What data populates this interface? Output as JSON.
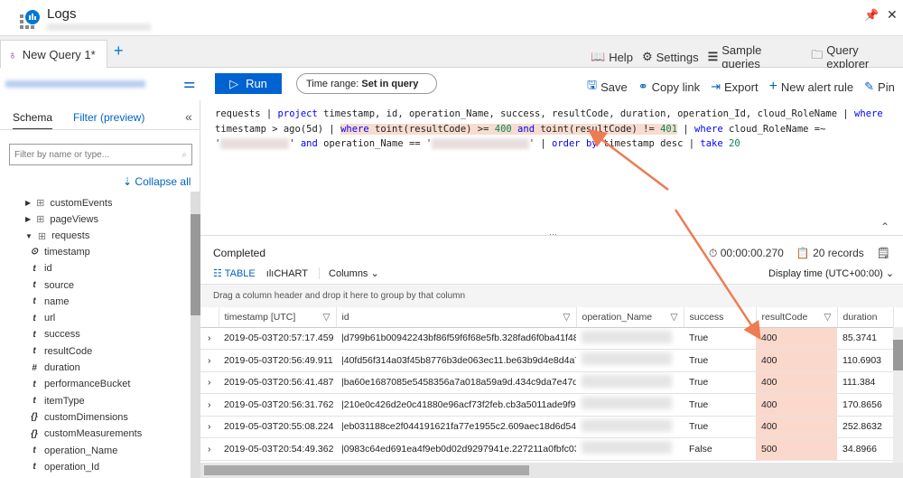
{
  "app": {
    "title": "Logs"
  },
  "tabs": [
    {
      "label": "New Query 1*"
    }
  ],
  "tabbar_actions": [
    {
      "label": "Help",
      "icon": "book-icon"
    },
    {
      "label": "Settings",
      "icon": "gear-icon"
    },
    {
      "label": "Sample queries",
      "icon": "list-icon"
    },
    {
      "label": "Query explorer",
      "icon": "folder-search-icon"
    }
  ],
  "toolbar": {
    "run": "Run",
    "time_range_label": "Time range:",
    "time_range_value": "Set in query",
    "actions": [
      {
        "label": "Save"
      },
      {
        "label": "Copy link"
      },
      {
        "label": "Export"
      },
      {
        "label": "New alert rule"
      },
      {
        "label": "Pin"
      }
    ]
  },
  "left": {
    "tab_schema": "Schema",
    "tab_filter": "Filter (preview)",
    "filter_placeholder": "Filter by name or type...",
    "collapse_all": "Collapse all",
    "tables": [
      {
        "label": "customEvents",
        "expanded": false
      },
      {
        "label": "pageViews",
        "expanded": false
      },
      {
        "label": "requests",
        "expanded": true
      }
    ],
    "fields": [
      {
        "type": "clock",
        "label": "timestamp"
      },
      {
        "type": "t",
        "label": "id"
      },
      {
        "type": "t",
        "label": "source"
      },
      {
        "type": "t",
        "label": "name"
      },
      {
        "type": "t",
        "label": "url"
      },
      {
        "type": "t",
        "label": "success"
      },
      {
        "type": "t",
        "label": "resultCode"
      },
      {
        "type": "#",
        "label": "duration"
      },
      {
        "type": "t",
        "label": "performanceBucket"
      },
      {
        "type": "t",
        "label": "itemType"
      },
      {
        "type": "{}",
        "label": "customDimensions"
      },
      {
        "type": "{}",
        "label": "customMeasurements"
      },
      {
        "type": "t",
        "label": "operation_Name"
      },
      {
        "type": "t",
        "label": "operation_Id"
      }
    ]
  },
  "query": [
    [
      [
        "requests | ",
        ""
      ],
      [
        "project",
        "kw"
      ],
      [
        " timestamp, id, operation_Name, success, resultCode, duration, operation_Id, cloud_RoleName | ",
        ""
      ],
      [
        "where",
        "kw"
      ]
    ],
    [
      [
        "timestamp > ago(5d) | ",
        ""
      ],
      [
        "where",
        "kw hl"
      ],
      [
        " toint(resultCode) >= ",
        "hl"
      ],
      [
        "400",
        "num hl"
      ],
      [
        " and",
        "kw hl"
      ],
      [
        " toint(resultCode) != ",
        "hl"
      ],
      [
        "401",
        "num hl"
      ],
      [
        " | ",
        ""
      ],
      [
        "where",
        "kw"
      ],
      [
        " cloud_RoleName =~",
        ""
      ]
    ],
    [
      [
        "'",
        ""
      ],
      [
        "xxxxxxxxxxxx",
        "blur"
      ],
      [
        "' ",
        ""
      ],
      [
        "and",
        "kw"
      ],
      [
        " operation_Name == '",
        ""
      ],
      [
        "xxxxxxxxxxxxxxxxx",
        "blur"
      ],
      [
        "' | ",
        ""
      ],
      [
        "order by",
        "kw"
      ],
      [
        " timestamp desc | ",
        ""
      ],
      [
        "take",
        "kw"
      ],
      [
        " ",
        ""
      ],
      [
        "20",
        "num"
      ]
    ]
  ],
  "results": {
    "status": "Completed",
    "duration": "00:00:00.270",
    "records": "20 records",
    "view_table": "TABLE",
    "view_chart": "CHART",
    "columns": "Columns",
    "display_time": "Display time (UTC+00:00)",
    "group_hint": "Drag a column header and drop it here to group by that column",
    "headers": [
      "timestamp [UTC]",
      "id",
      "operation_Name",
      "success",
      "resultCode",
      "duration"
    ],
    "rows": [
      [
        "2019-05-03T20:57:17.459",
        "|d799b61b00942243bf86f59f6f68e5fb.328fad6f0ba41f48.",
        "",
        "True",
        "400",
        "85.3741"
      ],
      [
        "2019-05-03T20:56:49.911",
        "|40fd56f314a03f45b8776b3de063ec11.be63b9d4e8d4a7...",
        "",
        "True",
        "400",
        "110.6903"
      ],
      [
        "2019-05-03T20:56:41.487",
        "|ba60e1687085e5458356a7a018a59a9d.434c9da7e47d5...",
        "",
        "True",
        "400",
        "111.384"
      ],
      [
        "2019-05-03T20:56:31.762",
        "|210e0c426d2e0c41880e96acf73f2feb.cb3a5011ade9f94f.",
        "",
        "True",
        "400",
        "170.8656"
      ],
      [
        "2019-05-03T20:55:08.224",
        "|eb031188ce2f044191621fa77e1955c2.609aec18d6d54a43.",
        "",
        "True",
        "400",
        "252.8632"
      ],
      [
        "2019-05-03T20:54:49.362",
        "|0983c64ed691ea4f9eb0d02d9297941e.227211a0fbfc03...",
        "",
        "False",
        "500",
        "34.8966"
      ]
    ]
  },
  "colors": {
    "accent": "#0063d1",
    "highlight": "#fbd8cc",
    "arrow": "#ee7b52"
  }
}
